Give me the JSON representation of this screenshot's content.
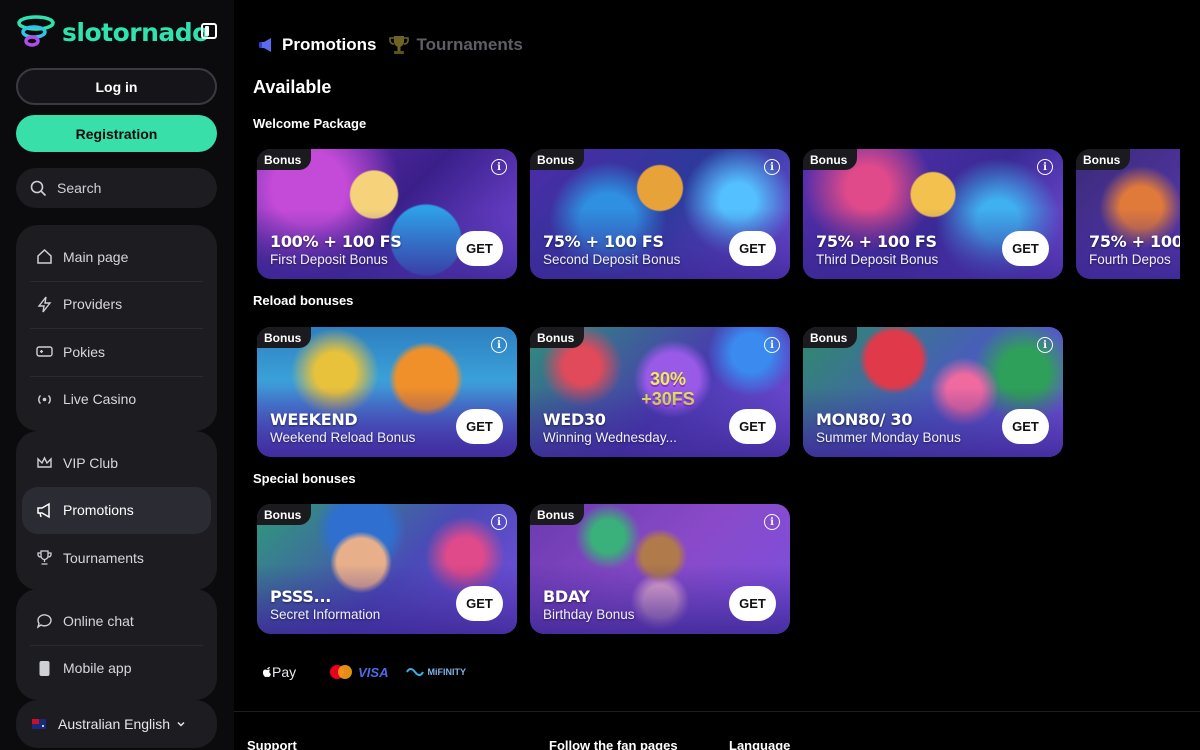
{
  "brand": {
    "name": "slotornado",
    "accent": "#2fe3b0"
  },
  "sidebar": {
    "login_label": "Log in",
    "register_label": "Registration",
    "search_placeholder": "Search",
    "group1": [
      {
        "label": "Main page",
        "icon": "home-icon"
      },
      {
        "label": "Providers",
        "icon": "lightning-icon"
      },
      {
        "label": "Pokies",
        "icon": "gamepad-icon"
      },
      {
        "label": "Live Casino",
        "icon": "broadcast-icon"
      }
    ],
    "group2": [
      {
        "label": "VIP Club",
        "icon": "crown-icon"
      },
      {
        "label": "Promotions",
        "icon": "megaphone-icon",
        "active": true
      },
      {
        "label": "Tournaments",
        "icon": "trophy-icon"
      }
    ],
    "group3": [
      {
        "label": "Online chat",
        "icon": "chat-icon"
      },
      {
        "label": "Mobile app",
        "icon": "phone-icon"
      }
    ],
    "language": "Australian English"
  },
  "tabs": [
    {
      "label": "Promotions",
      "icon": "megaphone-icon",
      "active": true
    },
    {
      "label": "Tournaments",
      "icon": "trophy-icon",
      "active": false
    }
  ],
  "heading": "Available",
  "sections": {
    "welcome": {
      "title": "Welcome Package",
      "cards": [
        {
          "badge": "Bonus",
          "title": "100% + 100 FS",
          "subtitle": "First Deposit Bonus",
          "cta": "GET"
        },
        {
          "badge": "Bonus",
          "title": "75% + 100 FS",
          "subtitle": "Second Deposit Bonus",
          "cta": "GET"
        },
        {
          "badge": "Bonus",
          "title": "75% + 100 FS",
          "subtitle": "Third Deposit Bonus",
          "cta": "GET"
        },
        {
          "badge": "Bonus",
          "title": "75% + 100",
          "subtitle": "Fourth Depos",
          "cta": ""
        }
      ]
    },
    "reload": {
      "title": "Reload bonuses",
      "cards": [
        {
          "badge": "Bonus",
          "title": "WEEKEND",
          "subtitle": "Weekend Reload Bonus",
          "cta": "GET"
        },
        {
          "badge": "Bonus",
          "title": "WED30",
          "subtitle": "Winning Wednesday...",
          "cta": "GET",
          "art_text": "30% +30FS"
        },
        {
          "badge": "Bonus",
          "title": "MON80/ 30",
          "subtitle": "Summer Monday Bonus",
          "cta": "GET"
        }
      ]
    },
    "special": {
      "title": "Special bonuses",
      "cards": [
        {
          "badge": "Bonus",
          "title": "PSSS...",
          "subtitle": "Secret Information",
          "cta": "GET"
        },
        {
          "badge": "Bonus",
          "title": "BDAY",
          "subtitle": "Birthday Bonus",
          "cta": "GET"
        }
      ]
    }
  },
  "payments": {
    "apple": "Pay",
    "visa": "VISA",
    "mifinity": "MiFINITY"
  },
  "footer": {
    "support": "Support",
    "follow": "Follow the fan pages",
    "language": "Language"
  }
}
